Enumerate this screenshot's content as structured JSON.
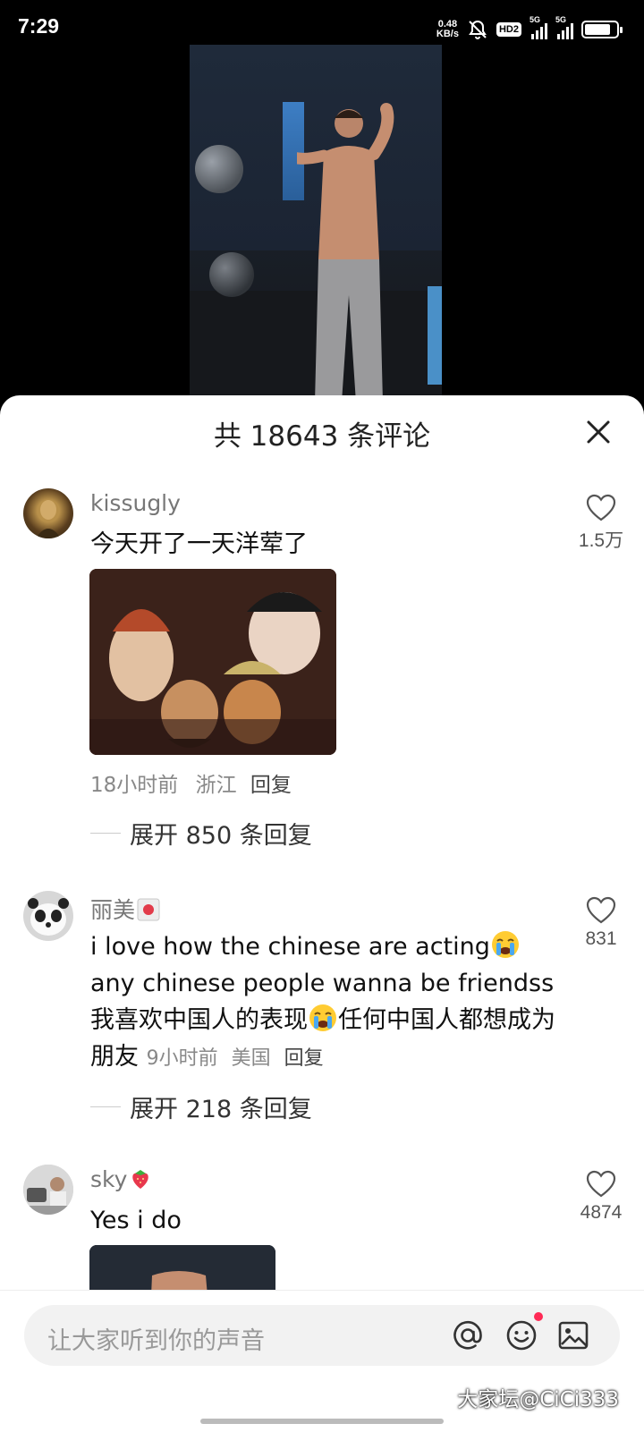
{
  "status_bar": {
    "time": "7:29",
    "net_speed_value": "0.48",
    "net_speed_unit": "KB/s",
    "hd_badge": "HD2",
    "signal1_label": "5G",
    "signal2_label": "5G"
  },
  "sheet": {
    "title": "共 18643 条评论"
  },
  "comments": [
    {
      "username": "kissugly",
      "text": "今天开了一天洋荤了",
      "time": "18小时前",
      "location": "浙江",
      "reply_label": "回复",
      "expand_label": "展开 850 条回复",
      "likes": "1.5万"
    },
    {
      "username": "丽美",
      "text_part1": "i love how the chinese are acting",
      "text_part2": " any chinese people wanna be friendss 我喜欢中国人的表现",
      "text_part3": "任何中国人都想成为朋友",
      "time": "9小时前",
      "location": "美国",
      "reply_label": "回复",
      "expand_label": "展开 218 条回复",
      "likes": "831"
    },
    {
      "username": "sky",
      "text": "Yes i  do",
      "likes": "4874"
    }
  ],
  "input_bar": {
    "placeholder": "让大家听到你的声音",
    "watermark": "大家坛@CiCi333"
  },
  "colors": {
    "like_heart": "#555555",
    "notification_dot": "#ff2a55",
    "sheet_bg": "#ffffff",
    "input_bg": "#f2f2f2"
  },
  "icons": [
    "close-icon",
    "heart-icon",
    "at-icon",
    "emoji-icon",
    "image-icon",
    "crying-emoji-icon",
    "flag-icon",
    "strawberry-icon"
  ]
}
